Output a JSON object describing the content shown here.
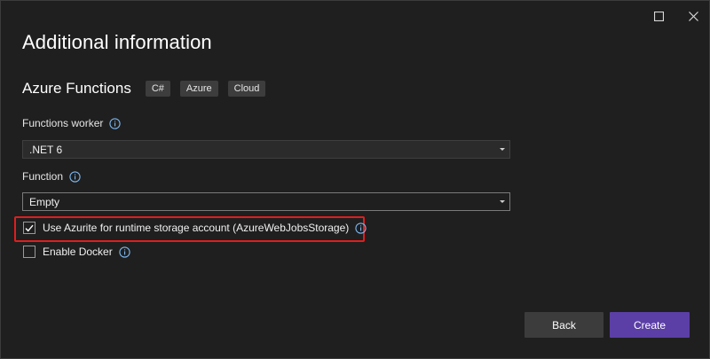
{
  "window": {
    "title": "Additional information",
    "controls": {
      "maximize_icon": "maximize-icon",
      "close_icon": "close-icon"
    }
  },
  "project": {
    "name": "Azure Functions",
    "tags": [
      "C#",
      "Azure",
      "Cloud"
    ]
  },
  "fields": {
    "functions_worker": {
      "label": "Functions worker",
      "value": ".NET 6",
      "icon": "info-icon"
    },
    "function": {
      "label": "Function",
      "value": "Empty",
      "icon": "info-icon"
    }
  },
  "options": {
    "use_azurite": {
      "label": "Use Azurite for runtime storage account (AzureWebJobsStorage)",
      "checked": true,
      "highlighted": true
    },
    "enable_docker": {
      "label": "Enable Docker",
      "checked": false
    }
  },
  "buttons": {
    "back": "Back",
    "create": "Create"
  },
  "colors": {
    "accent": "#5b3fa6",
    "highlight": "#e01e1e",
    "info": "#7cb7f0",
    "background": "#1f1f1f"
  }
}
